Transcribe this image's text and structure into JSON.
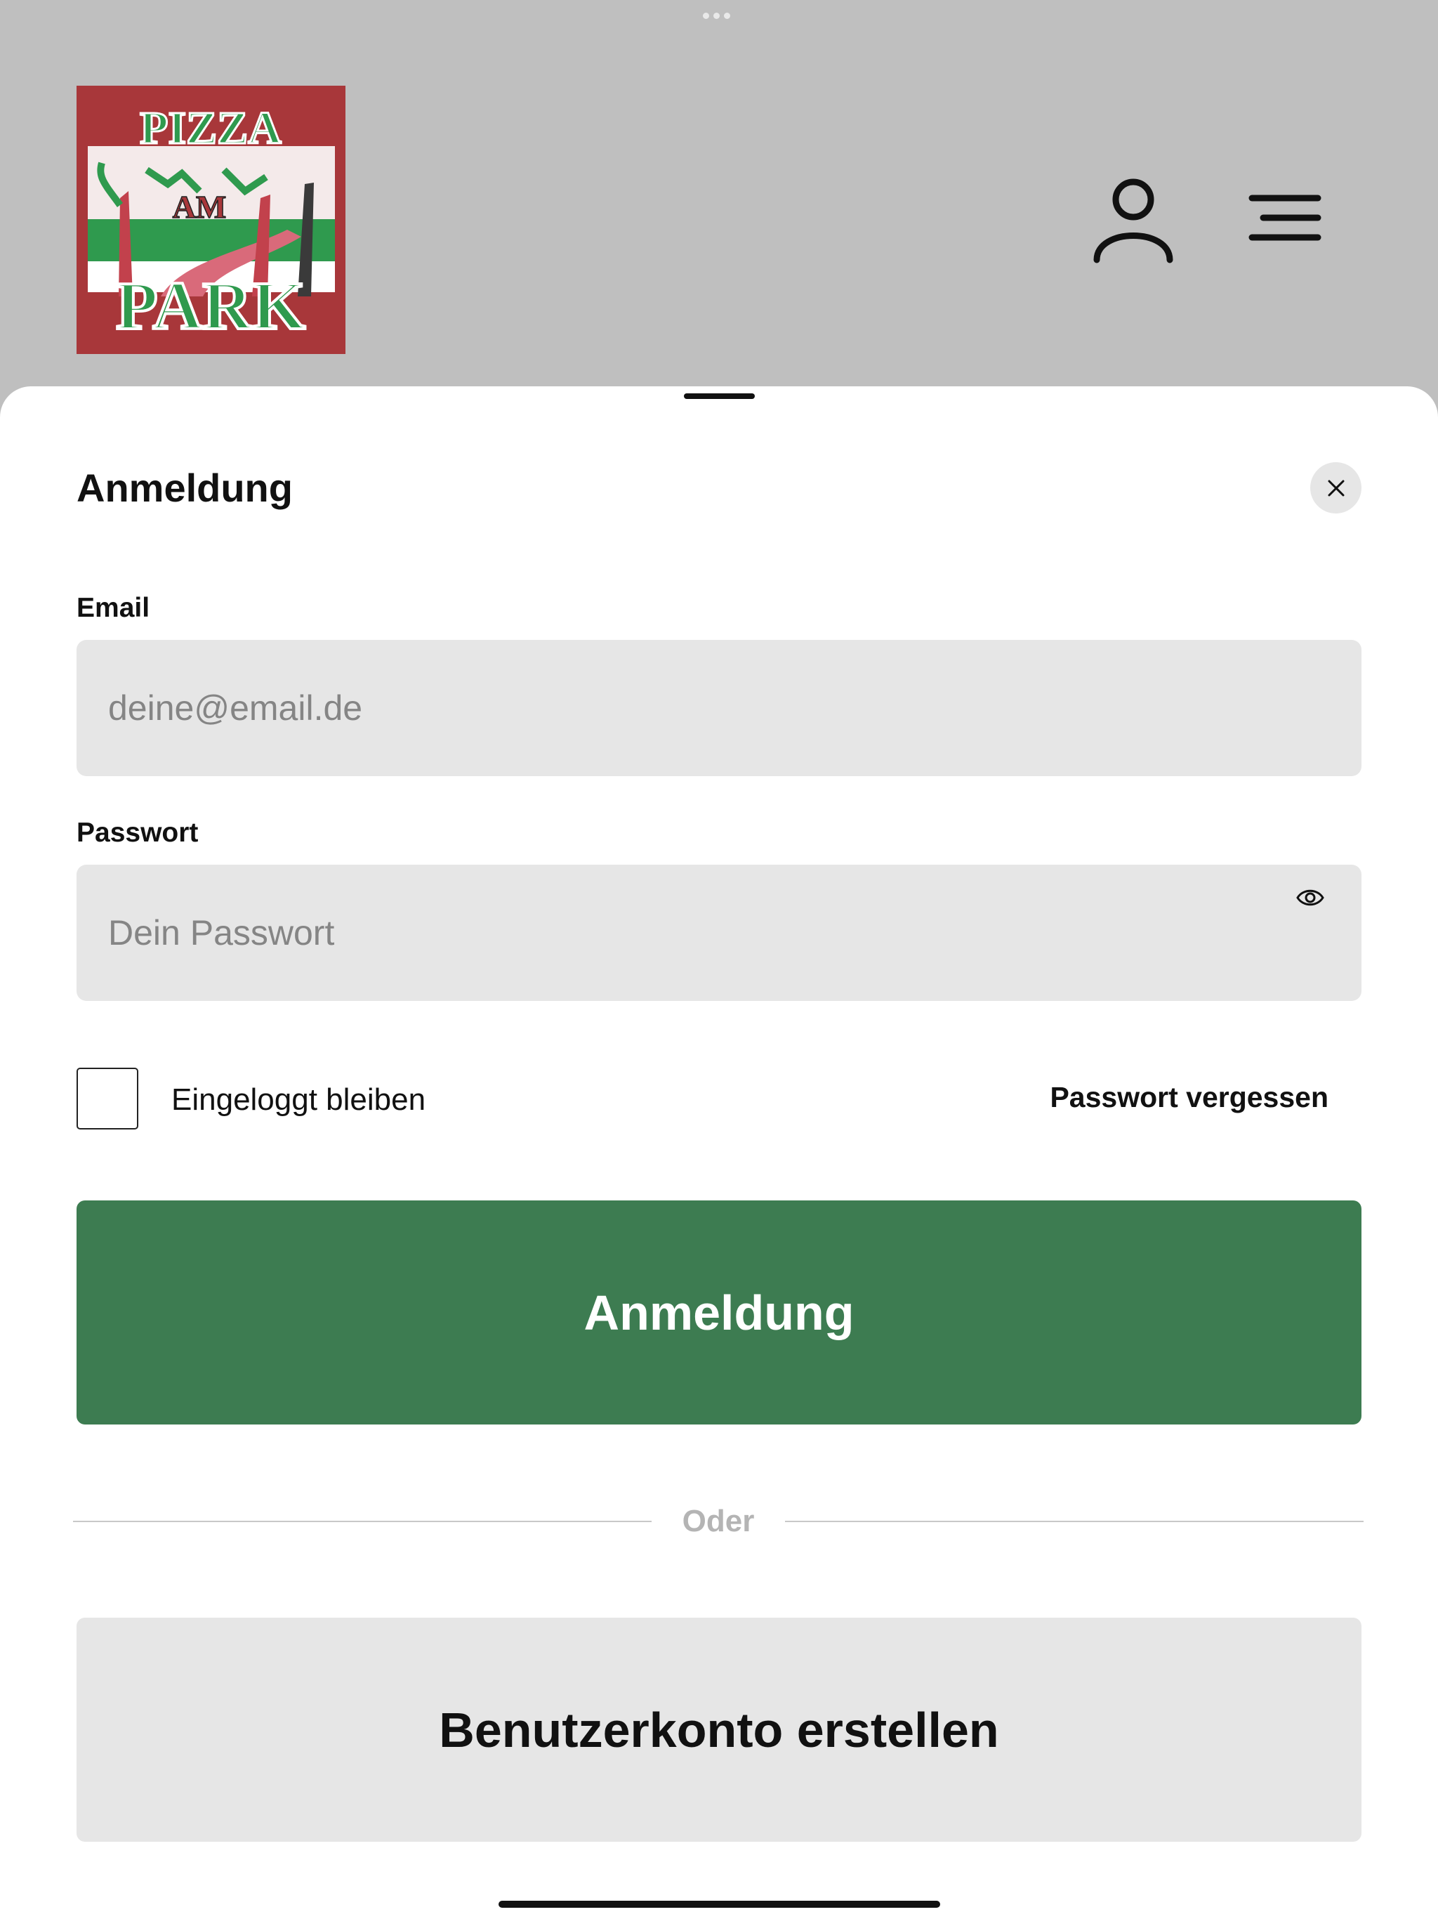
{
  "header": {
    "logo_text_top": "PIZZA",
    "logo_text_middle": "AM",
    "logo_text_bottom": "PARK",
    "icons": [
      "user-icon",
      "menu-icon"
    ]
  },
  "sheet": {
    "title": "Anmeldung",
    "close_icon": "close-icon"
  },
  "form": {
    "email_label": "Email",
    "email_placeholder": "deine@email.de",
    "password_label": "Passwort",
    "password_placeholder": "Dein Passwort",
    "password_toggle_icon": "eye-icon",
    "remember_label": "Eingeloggt bleiben",
    "remember_checked": false,
    "forgot_link": "Passwort vergessen",
    "submit_label": "Anmeldung",
    "divider_text": "Oder",
    "create_account_label": "Benutzerkonto erstellen"
  },
  "colors": {
    "primary": "#3d7c51",
    "backdrop": "#bfbfbf",
    "field_bg": "#e6e6e6",
    "logo_red": "#a8373a",
    "logo_green": "#2f9a4e"
  }
}
